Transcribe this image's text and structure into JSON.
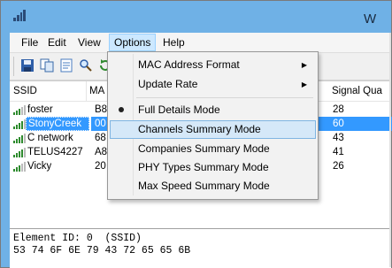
{
  "window": {
    "title": "W"
  },
  "menubar": {
    "items": [
      "File",
      "Edit",
      "View",
      "Options",
      "Help"
    ]
  },
  "listview": {
    "columns": [
      "SSID",
      "MA",
      "Signal Qua"
    ],
    "rows": [
      {
        "ssid": "foster",
        "mac": "B8",
        "signal": "28",
        "selected": false
      },
      {
        "ssid": "StonyCreek",
        "mac": "00",
        "signal": "60",
        "selected": true
      },
      {
        "ssid": "C network",
        "mac": "68",
        "signal": "43",
        "selected": false
      },
      {
        "ssid": "TELUS4227",
        "mac": "A8",
        "signal": "41",
        "selected": false
      },
      {
        "ssid": "Vicky",
        "mac": "20",
        "signal": "26",
        "selected": false
      }
    ]
  },
  "bottom_pane": {
    "line1": "Element ID: 0  (SSID)",
    "line2": "53 74 6F 6E 79 43 72 65 65 6B"
  },
  "options_menu": {
    "items": [
      {
        "label": "MAC Address Format",
        "submenu": true
      },
      {
        "label": "Update Rate",
        "submenu": true
      },
      {
        "label": "Full Details Mode",
        "checked": true
      },
      {
        "label": "Channels Summary Mode",
        "highlighted": true
      },
      {
        "label": "Companies Summary Mode"
      },
      {
        "label": "PHY Types Summary Mode"
      },
      {
        "label": "Max Speed Summary Mode"
      }
    ]
  },
  "colors": {
    "titlebar": "#6fb1e6",
    "selection": "#3399ff",
    "menu_highlight": "#d5e8f8"
  }
}
